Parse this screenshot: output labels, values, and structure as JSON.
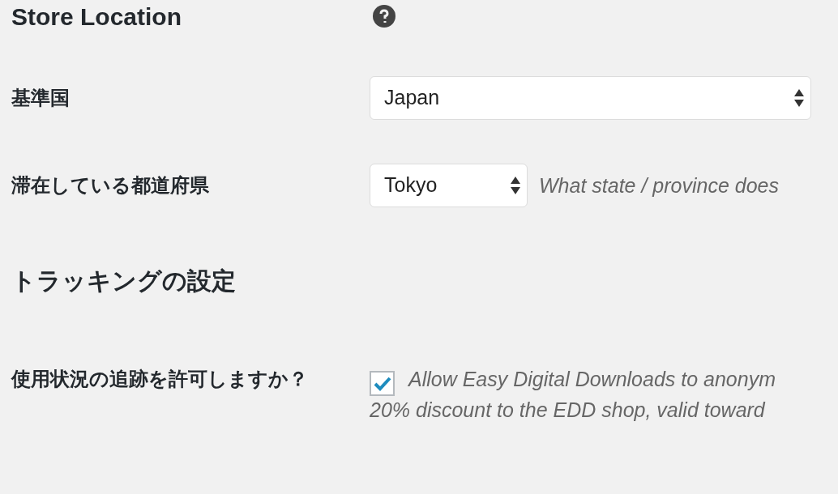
{
  "sections": [
    {
      "title": "Store Location",
      "help_icon": true,
      "fields": [
        {
          "kind": "select",
          "label": "基準国",
          "value": "Japan"
        },
        {
          "kind": "select",
          "label": "滞在している都道府県",
          "value": "Tokyo",
          "description": [
            "What state / province does"
          ]
        }
      ]
    },
    {
      "title": "トラッキングの設定",
      "help_icon": false,
      "fields": [
        {
          "kind": "checkbox",
          "label": "使用状況の追跡を許可しますか？",
          "checked": true,
          "description": [
            "Allow Easy Digital Downloads to anonym",
            "20% discount to the EDD shop, valid toward"
          ]
        }
      ]
    }
  ]
}
